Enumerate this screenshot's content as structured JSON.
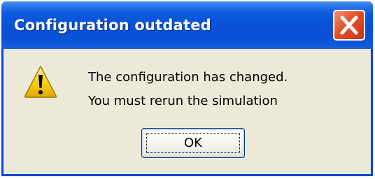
{
  "window": {
    "title": "Configuration outdated"
  },
  "titlebar": {
    "close_icon": "close-icon"
  },
  "content": {
    "icon": "warning-icon",
    "message_line1": "The configuration has changed.",
    "message_line2": "You must rerun the simulation"
  },
  "buttons": {
    "ok_label": "OK"
  },
  "colors": {
    "titlebar_blue": "#0852d6",
    "dialog_bg": "#ece9d8",
    "close_red": "#e2512b",
    "warning_yellow": "#f7d21c"
  }
}
